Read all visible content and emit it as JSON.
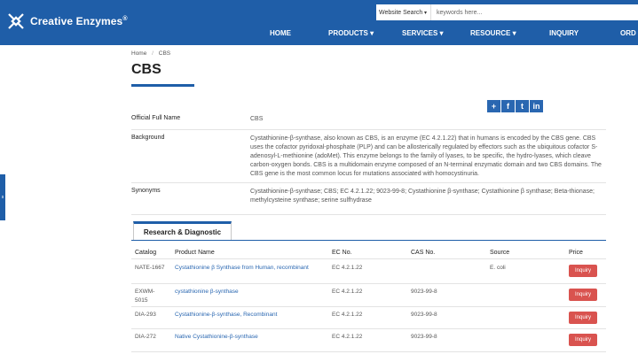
{
  "brand": {
    "name": "Creative Enzymes",
    "reg_mark": "®"
  },
  "search": {
    "scope": "Website Search",
    "placeholder": "keywords here..."
  },
  "nav": [
    {
      "label": "HOME"
    },
    {
      "label": "PRODUCTS ▾"
    },
    {
      "label": "SERVICES ▾"
    },
    {
      "label": "RESOURCE ▾"
    },
    {
      "label": "INQUIRY"
    },
    {
      "label": "ORD"
    }
  ],
  "breadcrumb": {
    "home": "Home",
    "sep": "/",
    "current": "CBS"
  },
  "page_title": "CBS",
  "share": [
    "+",
    "f",
    "t",
    "in"
  ],
  "side_tab": "s",
  "info": {
    "full_name_label": "Official Full Name",
    "full_name_value": "CBS",
    "background_label": "Background",
    "background_value": "Cystathionine-β-synthase, also known as CBS, is an enzyme (EC 4.2.1.22) that in humans is encoded by the CBS gene. CBS uses the cofactor pyridoxal-phosphate (PLP) and can be allosterically regulated by effectors such as the ubiquitous cofactor S-adenosyl-L-methionine (adoMet). This enzyme belongs to the family of lyases, to be specific, the hydro-lyases, which cleave carbon-oxygen bonds. CBS is a multidomain enzyme composed of an N-terminal enzymatic domain and two CBS domains. The CBS gene is the most common locus for mutations associated with homocystinuria.",
    "synonyms_label": "Synonyms",
    "synonyms_value": "Cystathionine-β-synthase; CBS; EC 4.2.1.22; 9023-99-8; Cystathionine β-synthase; Cystathionine β synthase; Beta-thionase; methylcysteine synthase; serine sulfhydrase"
  },
  "tab": {
    "label": "Research & Diagnostic"
  },
  "table": {
    "headers": {
      "catalog": "Catalog",
      "product": "Product Name",
      "ec": "EC No.",
      "cas": "CAS No.",
      "source": "Source",
      "price": "Price"
    },
    "rows": [
      {
        "catalog": "NATE-1667",
        "product": "Cystathionine β Synthase from Human, recombinant",
        "ec": "EC 4.2.1.22",
        "cas": "",
        "source": "E. coli",
        "action": "Inquiry"
      },
      {
        "catalog": "EXWM-5015",
        "product": "cystathionine β-synthase",
        "ec": "EC 4.2.1.22",
        "cas": "9023-99-8",
        "source": "",
        "action": "Inquiry"
      },
      {
        "catalog": "DIA-293",
        "product": "Cystathionine-β-synthase, Recombinant",
        "ec": "EC 4.2.1.22",
        "cas": "9023-99-8",
        "source": "",
        "action": "Inquiry"
      },
      {
        "catalog": "DIA-272",
        "product": "Native Cystathionine-β-synthase",
        "ec": "EC 4.2.1.22",
        "cas": "9023-99-8",
        "source": "",
        "action": "Inquiry"
      }
    ]
  },
  "colors": {
    "brand_blue": "#1f5ea8",
    "inquiry_red": "#d9534f",
    "link_blue": "#2a67b1"
  }
}
